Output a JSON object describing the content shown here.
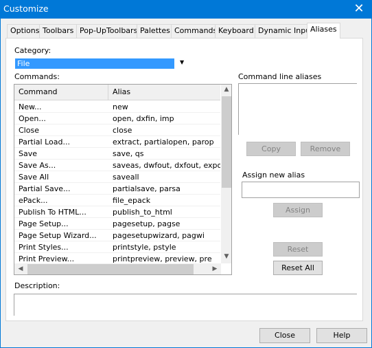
{
  "window": {
    "title": "Customize",
    "close_icon": "close-icon"
  },
  "tabs": [
    "Options",
    "Toolbars",
    "Pop-UpToolbars",
    "Palettes",
    "Commands",
    "Keyboard",
    "Dynamic Input",
    "Aliases"
  ],
  "active_tab": "Aliases",
  "category": {
    "label": "Category:",
    "value": "File"
  },
  "commands": {
    "label": "Commands:",
    "columns": [
      "Command",
      "Alias"
    ],
    "rows": [
      [
        "New...",
        "new"
      ],
      [
        "Open...",
        "open, dxfin, imp"
      ],
      [
        "Close",
        "close"
      ],
      [
        "Partial Load...",
        "extract, partialopen, parop"
      ],
      [
        "Save",
        "save, qs"
      ],
      [
        "Save As...",
        "saveas, dwfout, dxfout, export, -c"
      ],
      [
        "Save All",
        "saveall"
      ],
      [
        "Partial Save...",
        "partialsave, parsa"
      ],
      [
        "ePack...",
        "file_epack"
      ],
      [
        "Publish To HTML...",
        "publish_to_html"
      ],
      [
        "Page Setup...",
        "pagesetup, pagse"
      ],
      [
        "Page Setup Wizard...",
        "pagesetupwizard, pagwi"
      ],
      [
        "Print Styles...",
        "printstyle, pstyle"
      ],
      [
        "Print Preview...",
        "printpreview, preview, pre"
      ]
    ]
  },
  "aliases": {
    "label": "Command line aliases",
    "copy": "Copy",
    "remove": "Remove",
    "assign_label": "Assign new alias",
    "assign_value": "",
    "assign": "Assign",
    "reset": "Reset",
    "reset_all": "Reset All"
  },
  "description": {
    "label": "Description:",
    "value": ""
  },
  "footer": {
    "close": "Close",
    "help": "Help"
  }
}
